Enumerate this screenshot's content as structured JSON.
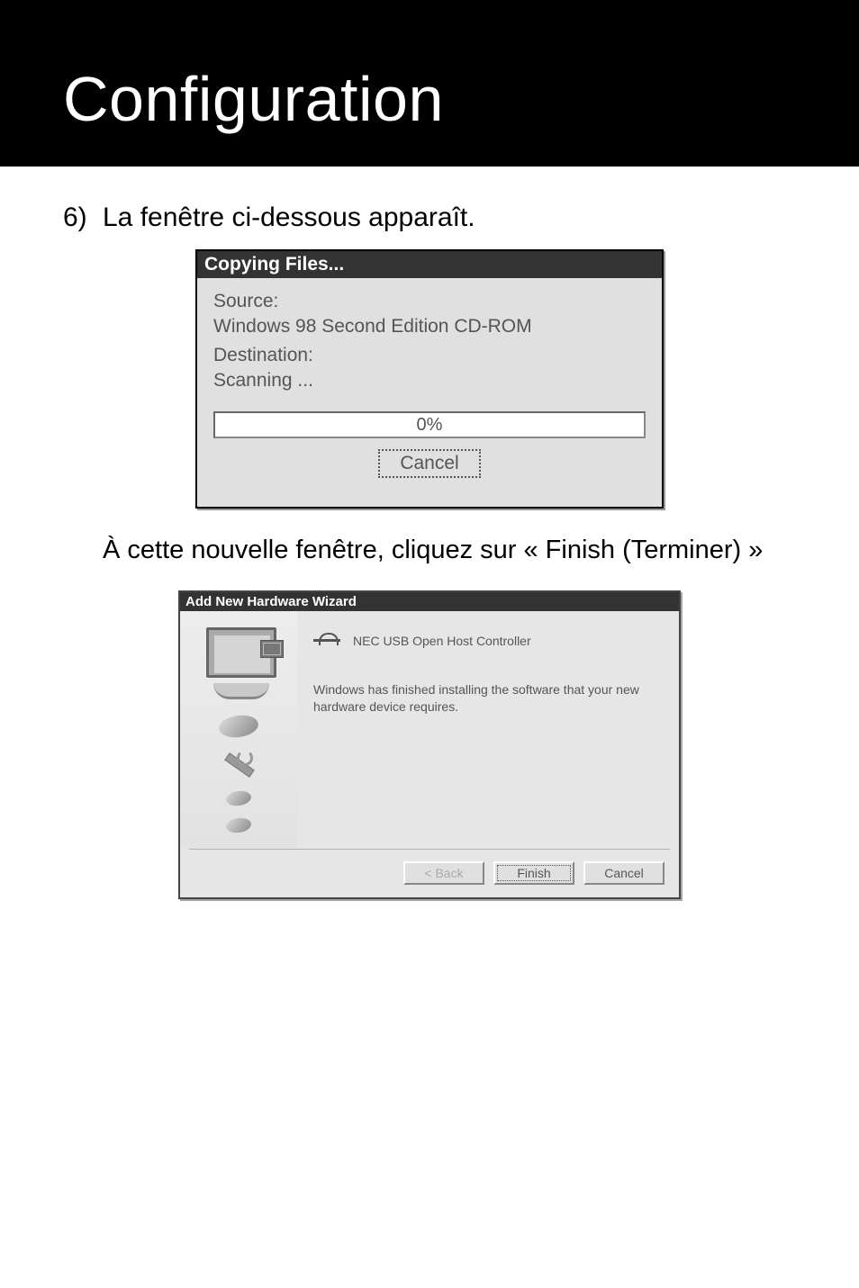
{
  "header": {
    "title": "Configuration"
  },
  "step": {
    "number": "6)",
    "text": "La fenêtre ci-dessous apparaît."
  },
  "copying_dialog": {
    "title": "Copying Files...",
    "source_label": "Source:",
    "source_value": "Windows 98 Second Edition CD-ROM",
    "destination_label": "Destination:",
    "destination_value": "Scanning ...",
    "progress_text": "0%",
    "cancel_label": "Cancel"
  },
  "mid_text": "À cette nouvelle fenêtre, cliquez sur « Finish (Terminer) »",
  "wizard_dialog": {
    "title": "Add New Hardware Wizard",
    "device_name": "NEC USB Open Host Controller",
    "message": "Windows has finished installing the software that your new hardware device requires.",
    "back_label": "< Back",
    "finish_label": "Finish",
    "cancel_label": "Cancel"
  }
}
